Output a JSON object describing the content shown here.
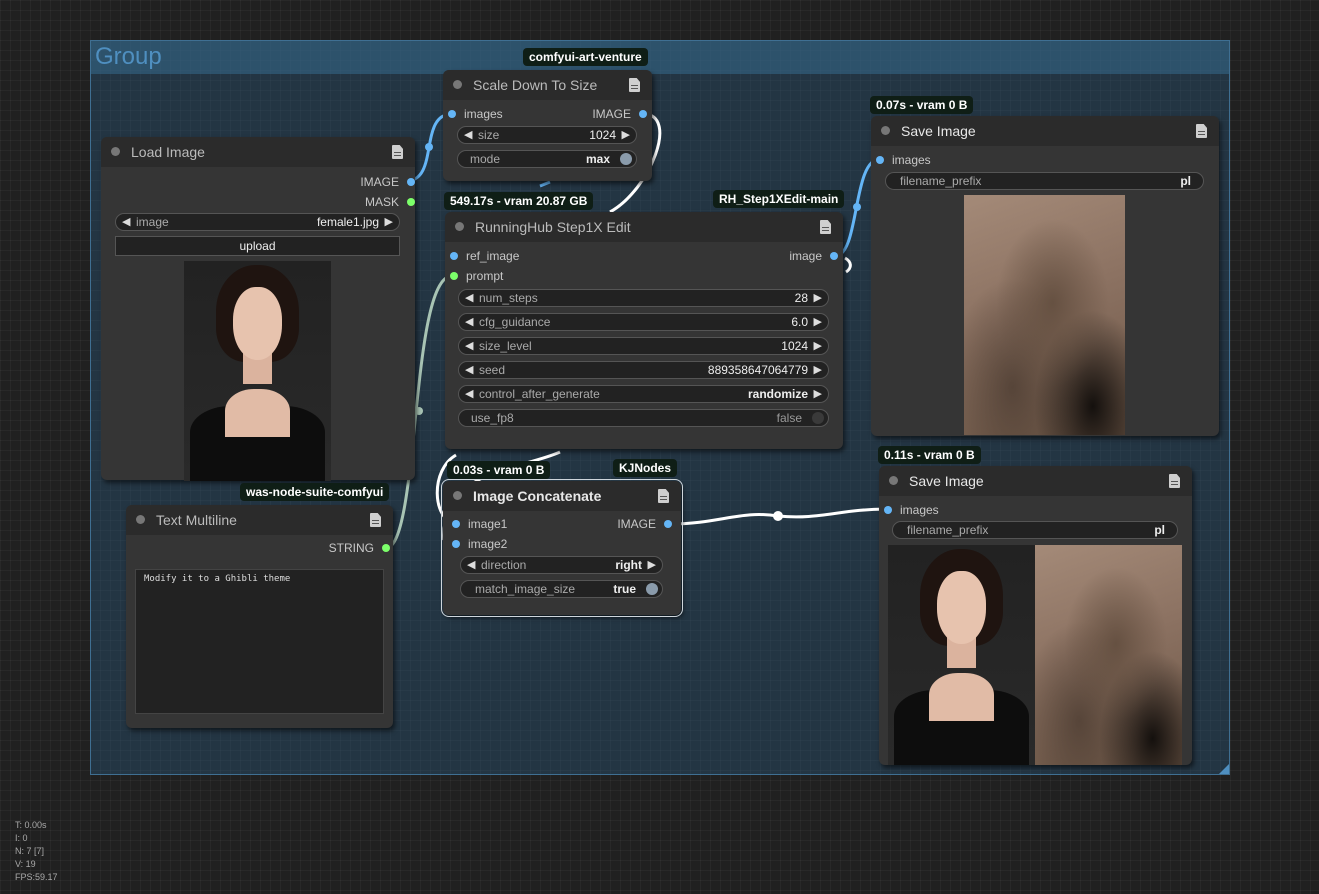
{
  "group": {
    "title": "Group"
  },
  "nodes": {
    "load_image": {
      "title": "Load Image",
      "outputs": [
        "IMAGE",
        "MASK"
      ],
      "image_widget": {
        "label": "image",
        "value": "female1.jpg"
      },
      "upload_label": "upload"
    },
    "scale_down": {
      "title": "Scale Down To Size",
      "badge": "comfyui-art-venture",
      "input": "images",
      "output": "IMAGE",
      "size": {
        "label": "size",
        "value": "1024"
      },
      "mode": {
        "label": "mode",
        "value": "max"
      }
    },
    "step1x": {
      "title": "RunningHub Step1X Edit",
      "time_badge": "549.17s - vram 20.87 GB",
      "badge": "RH_Step1XEdit-main",
      "inputs": [
        "ref_image",
        "prompt"
      ],
      "output": "image",
      "widgets": [
        {
          "label": "num_steps",
          "value": "28"
        },
        {
          "label": "cfg_guidance",
          "value": "6.0"
        },
        {
          "label": "size_level",
          "value": "1024"
        },
        {
          "label": "seed",
          "value": "889358647064779"
        },
        {
          "label": "control_after_generate",
          "value": "randomize"
        }
      ],
      "use_fp8": {
        "label": "use_fp8",
        "value": "false"
      }
    },
    "save_image_1": {
      "title": "Save Image",
      "time_badge": "0.07s - vram 0 B",
      "input": "images",
      "filename_prefix": {
        "label": "filename_prefix",
        "value": "pl"
      }
    },
    "text_multiline": {
      "title": "Text Multiline",
      "badge": "was-node-suite-comfyui",
      "output": "STRING",
      "text": "Modify it to a Ghibli theme"
    },
    "image_concat": {
      "title": "Image Concatenate",
      "time_badge": "0.03s - vram 0 B",
      "badge": "KJNodes",
      "inputs": [
        "image1",
        "image2"
      ],
      "output": "IMAGE",
      "direction": {
        "label": "direction",
        "value": "right"
      },
      "match_image_size": {
        "label": "match_image_size",
        "value": "true"
      }
    },
    "save_image_2": {
      "title": "Save Image",
      "time_badge": "0.11s - vram 0 B",
      "input": "images",
      "filename_prefix": {
        "label": "filename_prefix",
        "value": "pl"
      }
    }
  },
  "stats": {
    "t": "T: 0.00s",
    "i": "I: 0",
    "n": "N: 7 [7]",
    "v": "V: 19",
    "fps": "FPS:59.17"
  },
  "colors": {
    "link_image": "#64b5f6",
    "link_string": "#7cff6a",
    "group_fill": "#28506e",
    "node_body": "#353535"
  }
}
